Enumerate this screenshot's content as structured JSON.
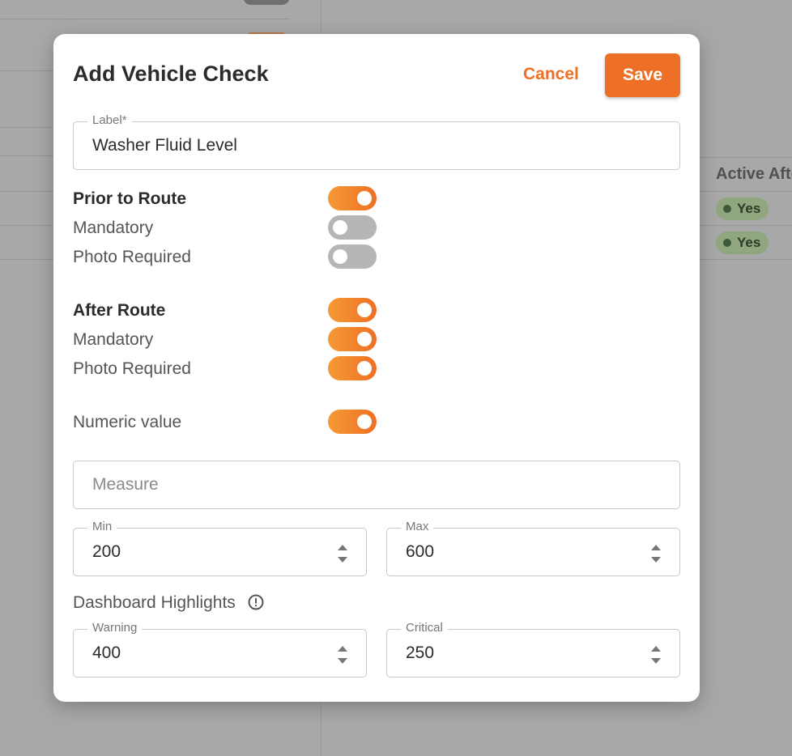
{
  "background": {
    "table_header": "Active Afte",
    "badges": [
      "Yes",
      "Yes"
    ]
  },
  "modal": {
    "title": "Add Vehicle Check",
    "cancel_label": "Cancel",
    "save_label": "Save",
    "label_field": {
      "label": "Label*",
      "value": "Washer Fluid Level"
    },
    "prior_to_route": {
      "heading": "Prior to Route",
      "heading_on": true,
      "mandatory_label": "Mandatory",
      "mandatory_on": false,
      "photo_label": "Photo Required",
      "photo_on": false
    },
    "after_route": {
      "heading": "After Route",
      "heading_on": true,
      "mandatory_label": "Mandatory",
      "mandatory_on": true,
      "photo_label": "Photo Required",
      "photo_on": true
    },
    "numeric": {
      "label": "Numeric value",
      "on": true
    },
    "measure": {
      "placeholder": "Measure"
    },
    "min": {
      "label": "Min",
      "value": "200"
    },
    "max": {
      "label": "Max",
      "value": "600"
    },
    "dashboard_highlights": {
      "label": "Dashboard Highlights",
      "icon": "info-icon"
    },
    "warning": {
      "label": "Warning",
      "value": "400"
    },
    "critical": {
      "label": "Critical",
      "value": "250"
    }
  },
  "colors": {
    "accent": "#ee7026",
    "toggle_off": "#b6b6b6",
    "badge": "#8fa67e"
  }
}
